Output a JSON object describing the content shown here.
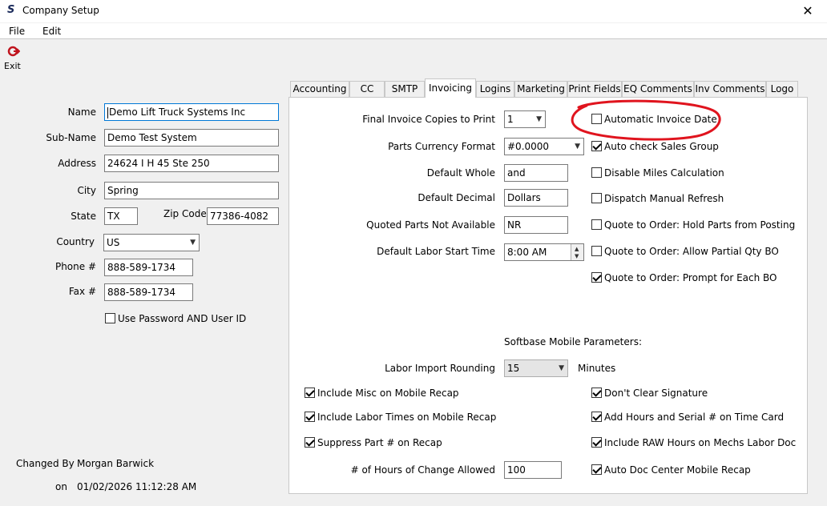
{
  "window": {
    "title": "Company Setup",
    "close_glyph": "✕"
  },
  "menu": {
    "file": "File",
    "edit": "Edit"
  },
  "toolbar": {
    "exit_label": "Exit"
  },
  "company": {
    "name_label": "Name",
    "name_value": "Demo Lift Truck Systems Inc",
    "subname_label": "Sub-Name",
    "subname_value": "Demo Test System",
    "address_label": "Address",
    "address_value": "24624 I H 45 Ste 250",
    "city_label": "City",
    "city_value": "Spring",
    "state_label": "State",
    "state_value": "TX",
    "zip_label": "Zip Code",
    "zip_value": "77386-4082",
    "country_label": "Country",
    "country_value": "US",
    "phone_label": "Phone #",
    "phone_value": "888-589-1734",
    "fax_label": "Fax #",
    "fax_value": "888-589-1734",
    "use_password_label": "Use Password AND User ID",
    "use_password_checked": false
  },
  "audit": {
    "changed_by_label": "Changed By",
    "changed_by_value": "Morgan Barwick",
    "on_label": "on",
    "on_value": "01/02/2026 11:12:28 AM"
  },
  "tabs": [
    "Accounting",
    "CC",
    "SMTP",
    "Invoicing",
    "Logins",
    "Marketing",
    "Print Fields",
    "EQ Comments",
    "Inv Comments",
    "Logo"
  ],
  "active_tab": "Invoicing",
  "invoicing": {
    "final_copies_label": "Final Invoice Copies to Print",
    "final_copies_value": "1",
    "parts_currency_label": "Parts Currency Format",
    "parts_currency_value": "#0.0000",
    "default_whole_label": "Default Whole",
    "default_whole_value": "and",
    "default_decimal_label": "Default Decimal",
    "default_decimal_value": "Dollars",
    "quoted_na_label": "Quoted Parts Not Available",
    "quoted_na_value": "NR",
    "labor_start_label": "Default Labor Start Time",
    "labor_start_value": "8:00 AM",
    "right_checks": [
      {
        "label": "Automatic Invoice Date",
        "checked": false
      },
      {
        "label": "Auto check Sales Group",
        "checked": true
      },
      {
        "label": "Disable Miles Calculation",
        "checked": false
      },
      {
        "label": "Dispatch Manual Refresh",
        "checked": false
      },
      {
        "label": "Quote to Order: Hold Parts from Posting",
        "checked": false
      },
      {
        "label": "Quote to Order: Allow Partial Qty BO",
        "checked": false
      },
      {
        "label": "Quote to Order: Prompt for Each BO",
        "checked": true
      }
    ],
    "mobile_heading": "Softbase Mobile Parameters:",
    "labor_rounding_label": "Labor Import Rounding",
    "labor_rounding_value": "15",
    "labor_rounding_unit": "Minutes",
    "mobile_left_checks": [
      {
        "label": "Include Misc on Mobile Recap",
        "checked": true
      },
      {
        "label": "Include Labor Times on Mobile Recap",
        "checked": true
      },
      {
        "label": "Suppress Part # on Recap",
        "checked": true
      }
    ],
    "hours_change_label": "# of Hours of Change Allowed",
    "hours_change_value": "100",
    "mobile_right_checks": [
      {
        "label": "Don't Clear Signature",
        "checked": true
      },
      {
        "label": "Add Hours and Serial # on Time Card",
        "checked": true
      },
      {
        "label": "Include RAW Hours on Mechs Labor Doc",
        "checked": true
      },
      {
        "label": "Auto Doc Center Mobile Recap",
        "checked": true
      }
    ]
  },
  "colors": {
    "annotation": "#e0141e",
    "exit_icon": "#c0141e",
    "focus_border": "#0078d7"
  }
}
